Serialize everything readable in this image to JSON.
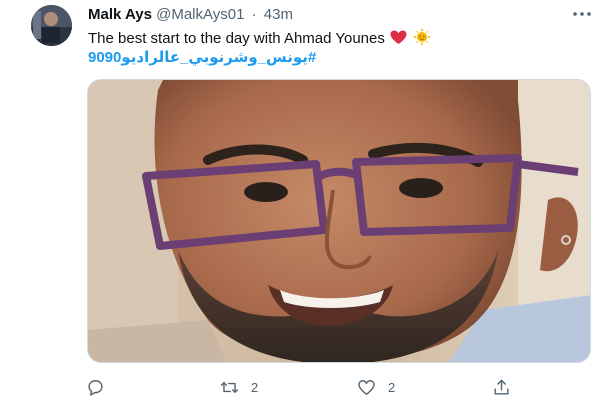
{
  "tweet": {
    "display_name": "Malk Ays",
    "handle": "@MalkAys01",
    "separator": "·",
    "time": "43m",
    "text": "The best start to the day with Ahmad Younes",
    "hashtag": "#يونس_وشرنوبي_عالراديو9090"
  },
  "actions": {
    "reply_icon": "reply-icon",
    "retweet_count": "2",
    "like_count": "2",
    "share_icon": "share-icon"
  },
  "colors": {
    "accent": "#1d9bf0",
    "muted": "#536471",
    "text": "#0f1419"
  }
}
